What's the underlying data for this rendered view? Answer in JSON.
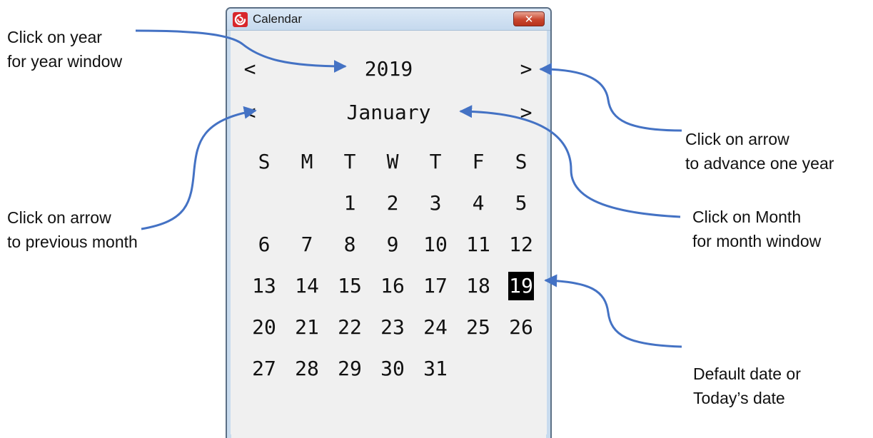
{
  "window": {
    "title": "Calendar",
    "close_glyph": "✕",
    "app_icon": "red-swirl-app-icon",
    "accent": "#d8262c"
  },
  "year_nav": {
    "prev": "<",
    "label": "2019",
    "next": ">"
  },
  "month_nav": {
    "prev": "<",
    "label": "January",
    "next": ">"
  },
  "weekdays": [
    "S",
    "M",
    "T",
    "W",
    "T",
    "F",
    "S"
  ],
  "weeks": [
    [
      "",
      "",
      "1",
      "2",
      "3",
      "4",
      "5"
    ],
    [
      "6",
      "7",
      "8",
      "9",
      "10",
      "11",
      "12"
    ],
    [
      "13",
      "14",
      "15",
      "16",
      "17",
      "18",
      "19"
    ],
    [
      "20",
      "21",
      "22",
      "23",
      "24",
      "25",
      "26"
    ],
    [
      "27",
      "28",
      "29",
      "30",
      "31",
      "",
      ""
    ]
  ],
  "selected_day": "19",
  "annotations": {
    "year_line1": "Click on year",
    "year_line2": "for year window",
    "prev_month_line1": "Click on arrow",
    "prev_month_line2": "to previous month",
    "advance_year_line1": "Click on arrow",
    "advance_year_line2": "to advance one year",
    "month_line1": "Click on Month",
    "month_line2": "for month window",
    "today_line1": "Default date or",
    "today_line2": "Today’s date",
    "arrow_color": "#4472c4"
  }
}
